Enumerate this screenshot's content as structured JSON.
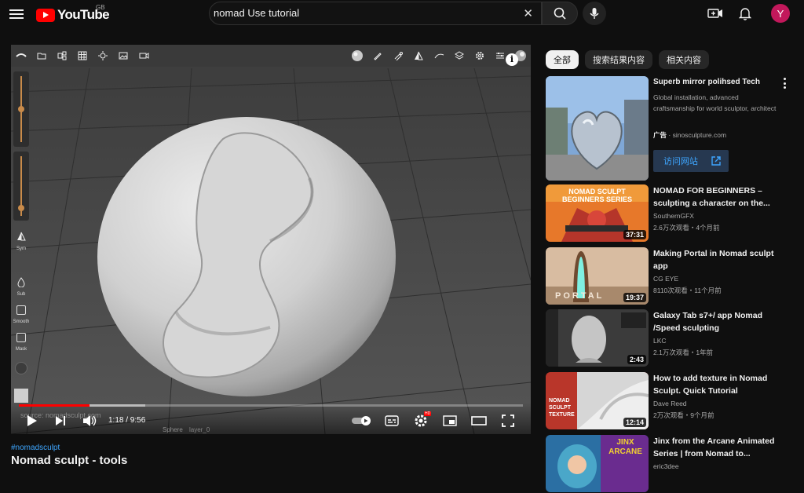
{
  "header": {
    "logo_text": "YouTube",
    "country_code": "GB",
    "search_value": "nomad Use tutorial",
    "avatar_letter": "Y"
  },
  "player": {
    "current_time": "1:18 / 9:56",
    "progress_fraction": 0.14,
    "buffer_fraction": 0.25,
    "source_text": "source: nomadsculpt.com",
    "sphere_label": "Sphere",
    "layer_label": "layer_0",
    "sym_label": "Sym",
    "sub_label": "Sub",
    "smooth_label": "Smooth",
    "mask_label": "Mask",
    "hd_badge": "HD"
  },
  "video": {
    "hashtag": "#nomadsculpt",
    "title": "Nomad sculpt - tools"
  },
  "filters": [
    "全部",
    "搜索结果内容",
    "相关内容"
  ],
  "ad": {
    "title": "Superb mirror polihsed Tech",
    "description": "Global installation, advanced craftsmanship for world sculptor, architect",
    "badge": "广告",
    "domain": "sinosculpture.com",
    "cta": "访问网站"
  },
  "recommendations": [
    {
      "title": "NOMAD FOR BEGINNERS – sculpting a character on the...",
      "channel": "SouthernGFX",
      "stats": "2.6万次观看・4个月前",
      "duration": "37:31",
      "thumb_text": "NOMAD SCULPT BEGINNERS SERIES",
      "thumb_color": "#d9541e"
    },
    {
      "title": "Making Portal in Nomad sculpt app",
      "channel": "CG EYE",
      "stats": "8110次观看・11个月前",
      "duration": "19:37",
      "thumb_text": "PORTAL",
      "thumb_color": "#c9a98c"
    },
    {
      "title": "Galaxy Tab s7+/ app Nomad /Speed sculpting",
      "channel": "LKC",
      "stats": "2.1万次观看・1年前",
      "duration": "2:43",
      "thumb_text": "",
      "thumb_color": "#3a3a3a"
    },
    {
      "title": "How to add texture in Nomad Sculpt. Quick Tutorial",
      "channel": "Dave Reed",
      "stats": "2万次观看・9个月前",
      "duration": "12:14",
      "thumb_text": "NOMAD SCULPT TEXTURE",
      "thumb_color": "#c0392b"
    },
    {
      "title": "Jinx from the Arcane Animated Series | from Nomad to...",
      "channel": "eric3dee",
      "stats": "",
      "duration": "",
      "thumb_text": "JINX ARCANE",
      "thumb_color": "#2b6fa3"
    }
  ]
}
